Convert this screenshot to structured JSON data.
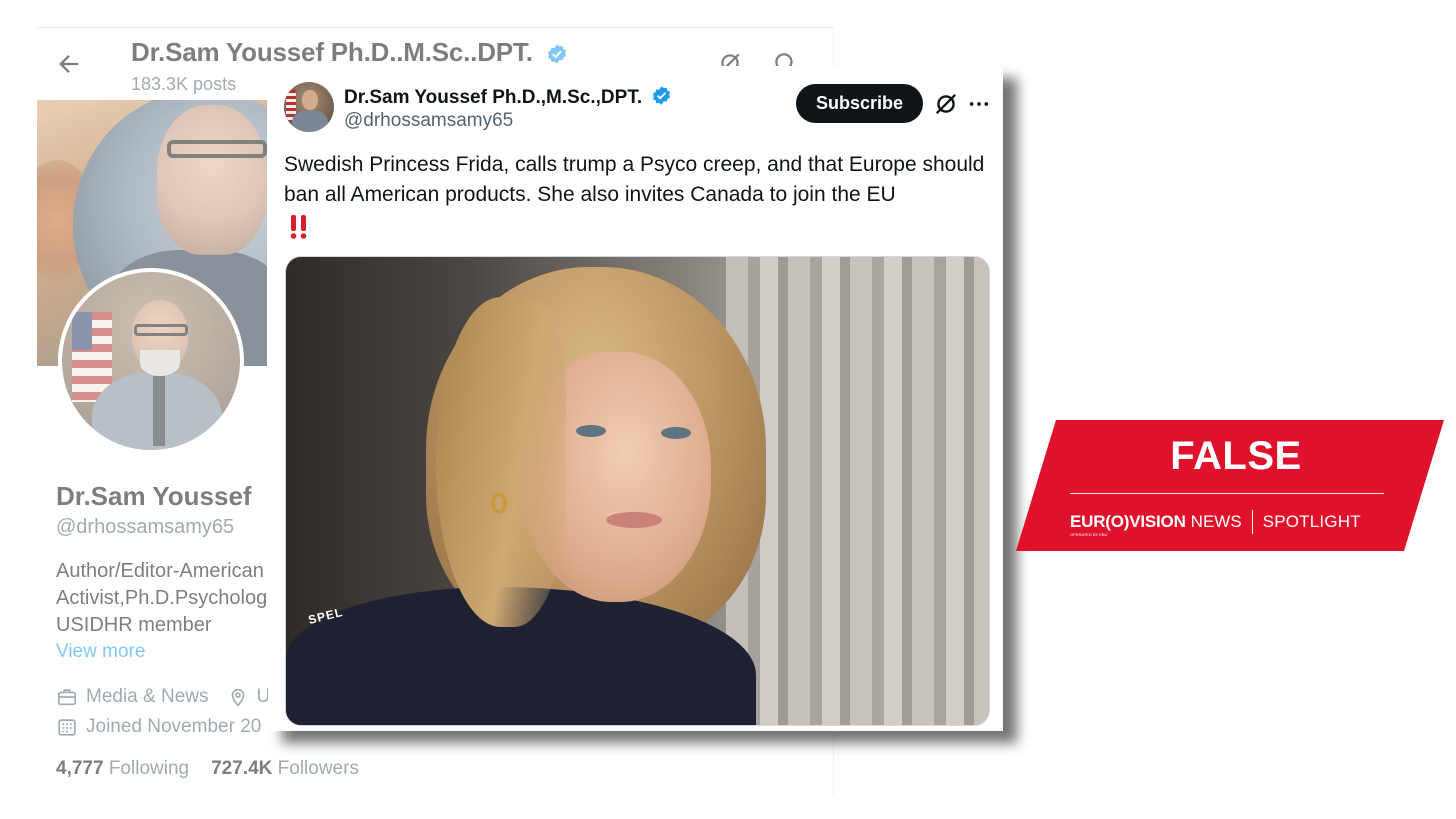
{
  "profile": {
    "header_name": "Dr.Sam Youssef Ph.D..M.Sc..DPT.",
    "posts": "183.3K posts",
    "display_name": "Dr.Sam Youssef",
    "handle": "@drhossamsamy65",
    "bio_lines": [
      "Author/Editor-American",
      "Activist,Ph.D.Psycholog",
      "USIDHR member"
    ],
    "view_more": "View more",
    "category": "Media & News",
    "location": "U",
    "joined": "Joined November 20",
    "following_count": "4,777",
    "following_label": "Following",
    "followers_count": "727.4K",
    "followers_label": "Followers"
  },
  "tweet": {
    "author_name": "Dr.Sam Youssef Ph.D.,M.Sc.,DPT.",
    "handle": "@drhossamsamy65",
    "subscribe_label": "Subscribe",
    "text": "Swedish Princess Frida, calls trump a Psyco creep, and that Europe should ban all American products. She also invites Canada to join the EU",
    "sweater_text": "SPEL"
  },
  "verdict": {
    "label": "FALSE",
    "brand_bold": "EUR(O)VISION",
    "brand_light": "NEWS",
    "brand_section": "SPOTLIGHT",
    "operated_by": "OPERATED BY EBU",
    "color": "#e0112b"
  },
  "colors": {
    "verified": "#1d9bf0",
    "link": "#1d9bf0",
    "muted": "#536471",
    "text": "#0f1419"
  }
}
